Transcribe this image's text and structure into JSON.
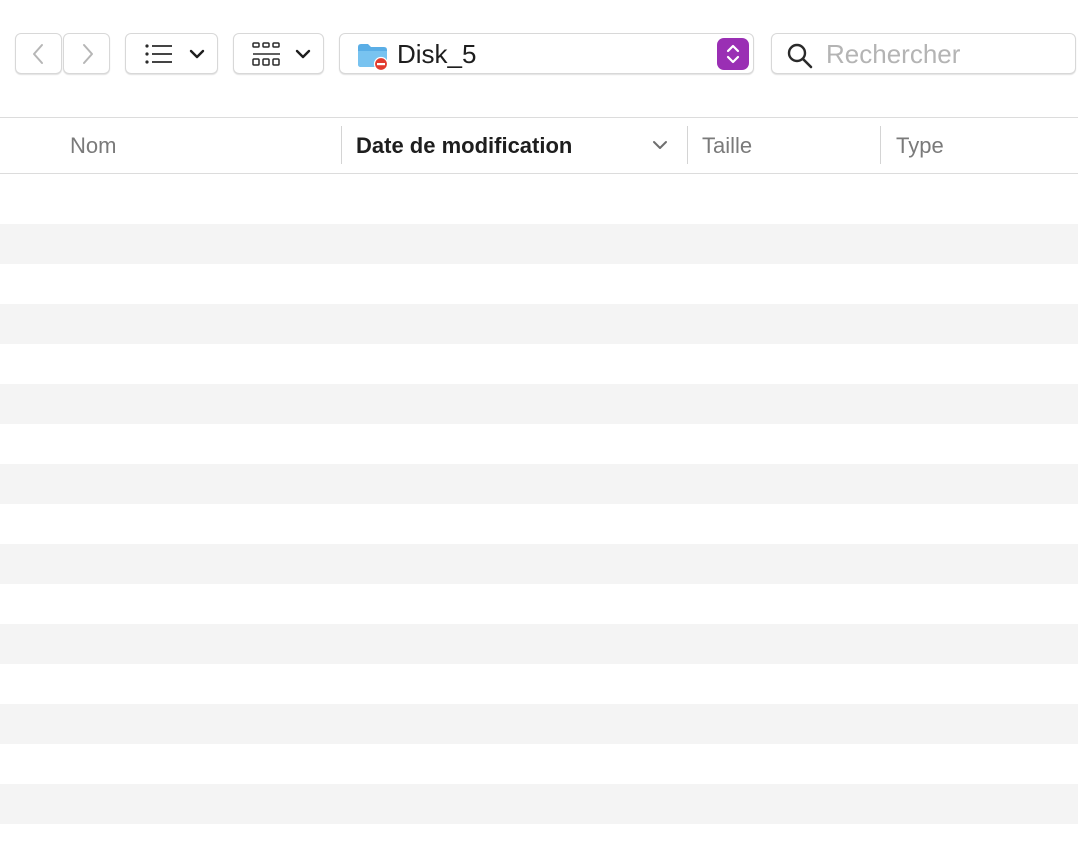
{
  "toolbar": {
    "back_icon": "chevron-left-icon",
    "forward_icon": "chevron-right-icon",
    "list_view_icon": "list-icon",
    "grid_view_icon": "grid-icon",
    "path": {
      "label": "Disk_5",
      "icon": "folder-icon",
      "accent_color": "#9a2fb4"
    },
    "search": {
      "placeholder": "Rechercher",
      "value": ""
    }
  },
  "columns": {
    "name": "Nom",
    "date": "Date de modification",
    "size": "Taille",
    "type": "Type",
    "sorted_by": "date"
  },
  "rows": []
}
